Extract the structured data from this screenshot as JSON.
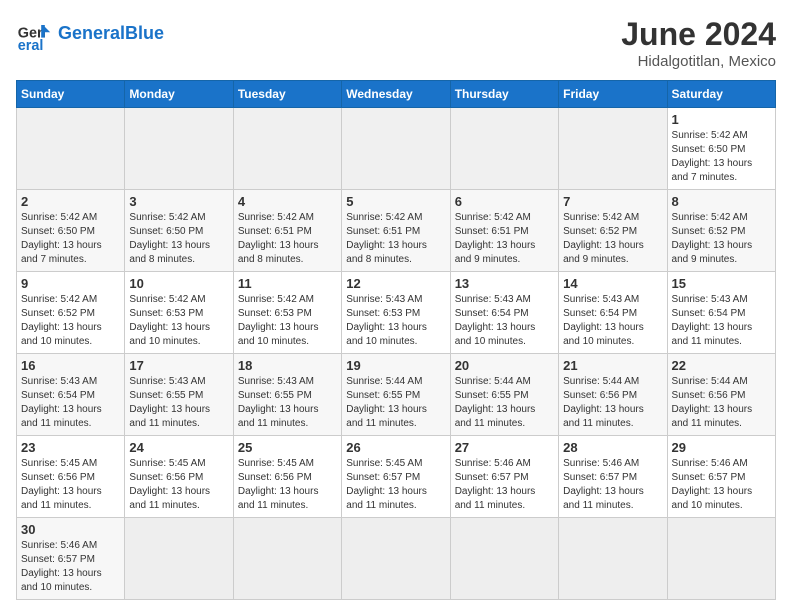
{
  "header": {
    "logo_general": "General",
    "logo_blue": "Blue",
    "month_title": "June 2024",
    "location": "Hidalgotitlan, Mexico"
  },
  "days_of_week": [
    "Sunday",
    "Monday",
    "Tuesday",
    "Wednesday",
    "Thursday",
    "Friday",
    "Saturday"
  ],
  "weeks": [
    [
      {
        "day": "",
        "info": ""
      },
      {
        "day": "",
        "info": ""
      },
      {
        "day": "",
        "info": ""
      },
      {
        "day": "",
        "info": ""
      },
      {
        "day": "",
        "info": ""
      },
      {
        "day": "",
        "info": ""
      },
      {
        "day": "1",
        "info": "Sunrise: 5:42 AM\nSunset: 6:50 PM\nDaylight: 13 hours\nand 7 minutes."
      }
    ],
    [
      {
        "day": "2",
        "info": "Sunrise: 5:42 AM\nSunset: 6:50 PM\nDaylight: 13 hours\nand 7 minutes."
      },
      {
        "day": "3",
        "info": "Sunrise: 5:42 AM\nSunset: 6:50 PM\nDaylight: 13 hours\nand 8 minutes."
      },
      {
        "day": "4",
        "info": "Sunrise: 5:42 AM\nSunset: 6:51 PM\nDaylight: 13 hours\nand 8 minutes."
      },
      {
        "day": "5",
        "info": "Sunrise: 5:42 AM\nSunset: 6:51 PM\nDaylight: 13 hours\nand 8 minutes."
      },
      {
        "day": "6",
        "info": "Sunrise: 5:42 AM\nSunset: 6:51 PM\nDaylight: 13 hours\nand 9 minutes."
      },
      {
        "day": "7",
        "info": "Sunrise: 5:42 AM\nSunset: 6:52 PM\nDaylight: 13 hours\nand 9 minutes."
      },
      {
        "day": "8",
        "info": "Sunrise: 5:42 AM\nSunset: 6:52 PM\nDaylight: 13 hours\nand 9 minutes."
      }
    ],
    [
      {
        "day": "9",
        "info": "Sunrise: 5:42 AM\nSunset: 6:52 PM\nDaylight: 13 hours\nand 10 minutes."
      },
      {
        "day": "10",
        "info": "Sunrise: 5:42 AM\nSunset: 6:53 PM\nDaylight: 13 hours\nand 10 minutes."
      },
      {
        "day": "11",
        "info": "Sunrise: 5:42 AM\nSunset: 6:53 PM\nDaylight: 13 hours\nand 10 minutes."
      },
      {
        "day": "12",
        "info": "Sunrise: 5:43 AM\nSunset: 6:53 PM\nDaylight: 13 hours\nand 10 minutes."
      },
      {
        "day": "13",
        "info": "Sunrise: 5:43 AM\nSunset: 6:54 PM\nDaylight: 13 hours\nand 10 minutes."
      },
      {
        "day": "14",
        "info": "Sunrise: 5:43 AM\nSunset: 6:54 PM\nDaylight: 13 hours\nand 10 minutes."
      },
      {
        "day": "15",
        "info": "Sunrise: 5:43 AM\nSunset: 6:54 PM\nDaylight: 13 hours\nand 11 minutes."
      }
    ],
    [
      {
        "day": "16",
        "info": "Sunrise: 5:43 AM\nSunset: 6:54 PM\nDaylight: 13 hours\nand 11 minutes."
      },
      {
        "day": "17",
        "info": "Sunrise: 5:43 AM\nSunset: 6:55 PM\nDaylight: 13 hours\nand 11 minutes."
      },
      {
        "day": "18",
        "info": "Sunrise: 5:43 AM\nSunset: 6:55 PM\nDaylight: 13 hours\nand 11 minutes."
      },
      {
        "day": "19",
        "info": "Sunrise: 5:44 AM\nSunset: 6:55 PM\nDaylight: 13 hours\nand 11 minutes."
      },
      {
        "day": "20",
        "info": "Sunrise: 5:44 AM\nSunset: 6:55 PM\nDaylight: 13 hours\nand 11 minutes."
      },
      {
        "day": "21",
        "info": "Sunrise: 5:44 AM\nSunset: 6:56 PM\nDaylight: 13 hours\nand 11 minutes."
      },
      {
        "day": "22",
        "info": "Sunrise: 5:44 AM\nSunset: 6:56 PM\nDaylight: 13 hours\nand 11 minutes."
      }
    ],
    [
      {
        "day": "23",
        "info": "Sunrise: 5:45 AM\nSunset: 6:56 PM\nDaylight: 13 hours\nand 11 minutes."
      },
      {
        "day": "24",
        "info": "Sunrise: 5:45 AM\nSunset: 6:56 PM\nDaylight: 13 hours\nand 11 minutes."
      },
      {
        "day": "25",
        "info": "Sunrise: 5:45 AM\nSunset: 6:56 PM\nDaylight: 13 hours\nand 11 minutes."
      },
      {
        "day": "26",
        "info": "Sunrise: 5:45 AM\nSunset: 6:57 PM\nDaylight: 13 hours\nand 11 minutes."
      },
      {
        "day": "27",
        "info": "Sunrise: 5:46 AM\nSunset: 6:57 PM\nDaylight: 13 hours\nand 11 minutes."
      },
      {
        "day": "28",
        "info": "Sunrise: 5:46 AM\nSunset: 6:57 PM\nDaylight: 13 hours\nand 11 minutes."
      },
      {
        "day": "29",
        "info": "Sunrise: 5:46 AM\nSunset: 6:57 PM\nDaylight: 13 hours\nand 10 minutes."
      }
    ],
    [
      {
        "day": "30",
        "info": "Sunrise: 5:46 AM\nSunset: 6:57 PM\nDaylight: 13 hours\nand 10 minutes."
      },
      {
        "day": "",
        "info": ""
      },
      {
        "day": "",
        "info": ""
      },
      {
        "day": "",
        "info": ""
      },
      {
        "day": "",
        "info": ""
      },
      {
        "day": "",
        "info": ""
      },
      {
        "day": "",
        "info": ""
      }
    ]
  ]
}
